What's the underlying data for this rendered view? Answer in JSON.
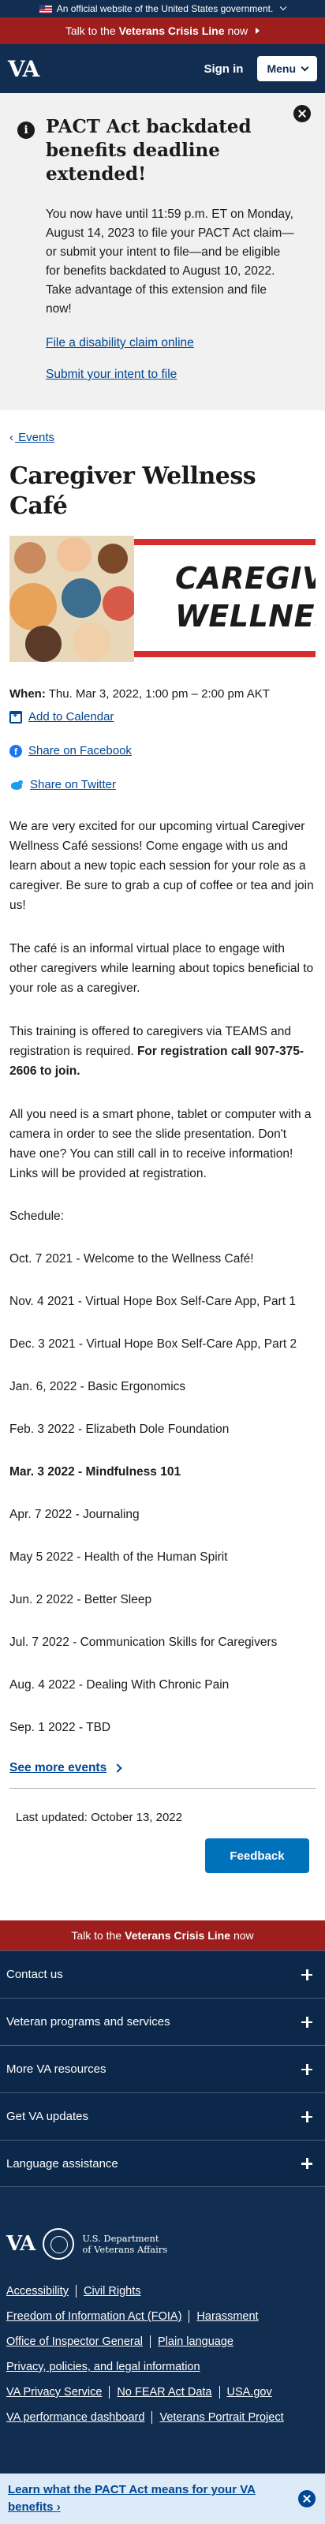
{
  "banner": {
    "text": "An official website of the United States government."
  },
  "crisis": {
    "prefix": "Talk to the ",
    "bold": "Veterans Crisis Line",
    "suffix": " now"
  },
  "header": {
    "logo": "VA",
    "signin": "Sign in",
    "menu": "Menu"
  },
  "alert": {
    "title": "PACT Act backdated benefits deadline extended!",
    "body": "You now have until 11:59 p.m. ET on Monday, August 14, 2023 to file your PACT Act claim—or submit your intent to file—and be eligible for benefits backdated to August 10, 2022. Take advantage of this extension and file now!",
    "link1": "File a disability claim online",
    "link2": "Submit your intent to file"
  },
  "breadcrumb": {
    "label": "Events"
  },
  "event": {
    "title": "Caregiver Wellness Café",
    "hero_text_line1": "CAREGIVER",
    "hero_text_line2": "WELLNESS C",
    "when_label": "When:",
    "when_value": " Thu. Mar 3, 2022, 1:00 pm – 2:00 pm AKT",
    "add_calendar": "Add to Calendar",
    "share_facebook": "Share on Facebook",
    "share_twitter": "Share on Twitter",
    "p1": "We are very excited for our upcoming virtual Caregiver Wellness Café sessions! Come engage with us and learn about a new topic each session for your role as a caregiver. Be sure to grab a cup of coffee or tea and join us!",
    "p2": "The café is an informal virtual place to engage with other caregivers while learning about topics beneficial to your role as a caregiver.",
    "p3_text": "This training is offered to caregivers via TEAMS and registration is required. ",
    "p3_bold": "For registration call 907-375-2606 to join.",
    "p4": "All you need is a smart phone, tablet or computer with a camera in order to see the slide presentation. Don't have one? You can still call in to receive information! Links will be provided at registration.",
    "schedule_label": "Schedule:",
    "schedule": [
      "Oct. 7 2021 - Welcome to the Wellness Café!",
      "Nov. 4 2021 - Virtual Hope Box Self-Care App, Part 1",
      "Dec. 3 2021 - Virtual Hope Box Self-Care App, Part 2",
      "Jan. 6, 2022 - Basic Ergonomics",
      "Feb. 3 2022 - Elizabeth Dole Foundation",
      "Mar. 3 2022 - Mindfulness 101",
      "Apr. 7 2022 - Journaling",
      "May 5 2022 - Health of the Human Spirit",
      "Jun. 2 2022 - Better Sleep",
      "Jul. 7 2022 - Communication Skills for Caregivers",
      "Aug. 4 2022 - Dealing With Chronic Pain",
      "Sep. 1 2022 - TBD"
    ],
    "see_more": "See more events",
    "last_updated": "Last updated: October 13, 2022",
    "feedback": "Feedback"
  },
  "footer": {
    "accordion": [
      "Contact us",
      "Veteran programs and services",
      "More VA resources",
      "Get VA updates",
      "Language assistance"
    ],
    "logo": "VA",
    "dept_line1": "U.S. Department",
    "dept_line2": "of Veterans Affairs",
    "links": {
      "accessibility": "Accessibility",
      "civil_rights": "Civil Rights",
      "foia": "Freedom of Information Act (FOIA)",
      "harassment": "Harassment",
      "oig": "Office of Inspector General",
      "plain_language": "Plain language",
      "privacy": "Privacy, policies, and legal information",
      "privacy_service": "VA Privacy Service",
      "no_fear": "No FEAR Act Data",
      "usagov": "USA.gov",
      "dashboard": "VA performance dashboard",
      "portrait": "Veterans Portrait Project"
    },
    "pact_line1": "Learn what the PACT Act means for your VA",
    "pact_line2": "benefits"
  },
  "colors": {
    "navy": "#112e51",
    "crisis_red": "#9e1d1d",
    "link_blue": "#004795",
    "button_blue": "#0071bb",
    "alert_gray": "#f1f1f1"
  }
}
